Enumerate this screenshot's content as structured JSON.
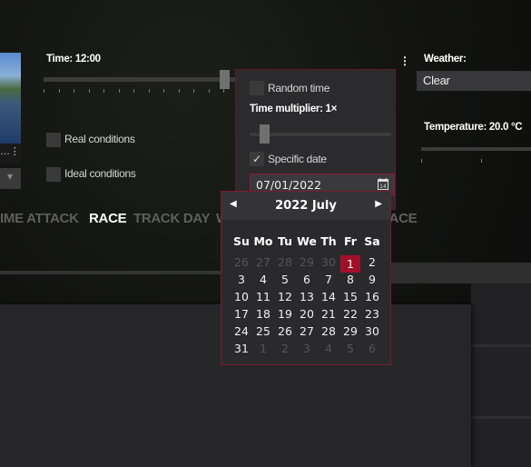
{
  "left": {
    "thumbnail_caption": "…",
    "time_label": "Time: 12:00",
    "time_value": 0.95,
    "real_conditions": {
      "label": "Real conditions",
      "checked": false
    },
    "ideal_conditions": {
      "label": "Ideal conditions",
      "checked": false
    }
  },
  "mode_tabs": [
    {
      "label": "IME ATTACK",
      "active": false
    },
    {
      "label": "RACE",
      "active": true
    },
    {
      "label": "TRACK DAY",
      "active": false
    },
    {
      "label": "W",
      "active": false
    },
    {
      "label": "RACE",
      "active": false
    }
  ],
  "time_popup": {
    "random_time": {
      "label": "Random time",
      "checked": false
    },
    "multiplier_label": "Time multiplier: 1×",
    "multiplier_value": 0.05,
    "specific_date": {
      "label": "Specific date",
      "checked": true
    },
    "date_value": "07/01/2022",
    "calendar_icon": "calendar-icon"
  },
  "calendar": {
    "title": "2022 July",
    "weekdays": [
      "Su",
      "Mo",
      "Tu",
      "We",
      "Th",
      "Fr",
      "Sa"
    ],
    "weeks": [
      [
        "26",
        "27",
        "28",
        "29",
        "30",
        "1",
        "2"
      ],
      [
        "3",
        "4",
        "5",
        "6",
        "7",
        "8",
        "9"
      ],
      [
        "10",
        "11",
        "12",
        "13",
        "14",
        "15",
        "16"
      ],
      [
        "17",
        "18",
        "19",
        "20",
        "21",
        "22",
        "23"
      ],
      [
        "24",
        "25",
        "26",
        "27",
        "28",
        "29",
        "30"
      ],
      [
        "31",
        "1",
        "2",
        "3",
        "4",
        "5",
        "6"
      ]
    ],
    "dim": [
      [
        0,
        0
      ],
      [
        0,
        1
      ],
      [
        0,
        2
      ],
      [
        0,
        3
      ],
      [
        0,
        4
      ],
      [
        5,
        1
      ],
      [
        5,
        2
      ],
      [
        5,
        3
      ],
      [
        5,
        4
      ],
      [
        5,
        5
      ],
      [
        5,
        6
      ]
    ],
    "selected": [
      0,
      5
    ],
    "accent": "#a0102a"
  },
  "right": {
    "weather_label": "Weather:",
    "weather_value": "Clear",
    "temperature_label": "Temperature: 20.0 °C"
  }
}
